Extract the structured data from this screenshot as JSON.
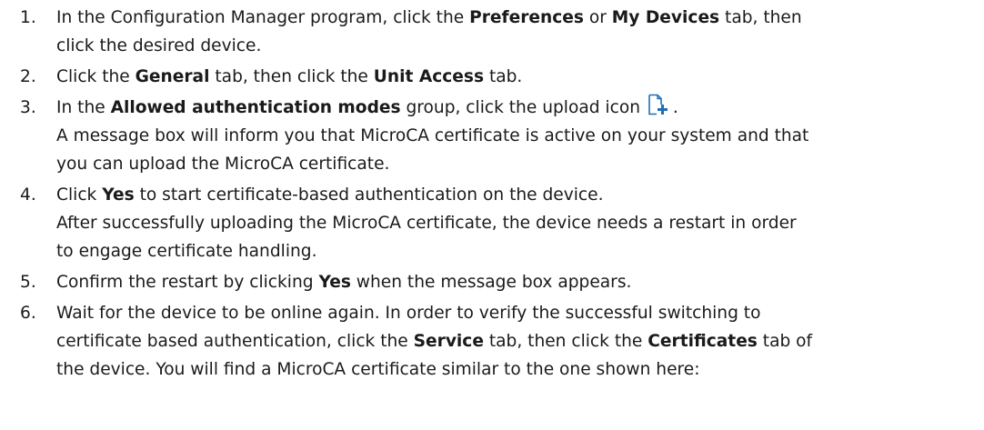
{
  "steps": [
    {
      "number": "1.",
      "lines": [
        [
          {
            "t": "In the Configuration Manager program, click the "
          },
          {
            "t": "Preferences",
            "b": true
          },
          {
            "t": " or "
          },
          {
            "t": "My Devices",
            "b": true
          },
          {
            "t": " tab, then"
          }
        ],
        [
          {
            "t": "click the desired device."
          }
        ]
      ]
    },
    {
      "number": "2.",
      "lines": [
        [
          {
            "t": "Click the "
          },
          {
            "t": "General",
            "b": true
          },
          {
            "t": " tab, then click the "
          },
          {
            "t": "Unit Access",
            "b": true
          },
          {
            "t": " tab."
          }
        ]
      ]
    },
    {
      "number": "3.",
      "lines": [
        [
          {
            "t": "In the "
          },
          {
            "t": "Allowed authentication modes",
            "b": true
          },
          {
            "t": " group, click the upload icon "
          },
          {
            "icon": "upload-icon"
          },
          {
            "t": "."
          }
        ],
        [
          {
            "t": "A message box will inform you that MicroCA certificate is active on your system and that"
          }
        ],
        [
          {
            "t": "you can upload the MicroCA certificate."
          }
        ]
      ]
    },
    {
      "number": "4.",
      "lines": [
        [
          {
            "t": "Click "
          },
          {
            "t": "Yes",
            "b": true
          },
          {
            "t": " to start certificate-based authentication on the device."
          }
        ],
        [
          {
            "t": "After successfully uploading the MicroCA certificate, the device needs a restart in order"
          }
        ],
        [
          {
            "t": "to engage certificate handling."
          }
        ]
      ]
    },
    {
      "number": "5.",
      "lines": [
        [
          {
            "t": "Confirm the restart by clicking "
          },
          {
            "t": "Yes",
            "b": true
          },
          {
            "t": " when the message box appears."
          }
        ]
      ]
    },
    {
      "number": "6.",
      "lines": [
        [
          {
            "t": "Wait for the device to be online again. In order to verify the successful switching to"
          }
        ],
        [
          {
            "t": "certificate based authentication, click the "
          },
          {
            "t": "Service",
            "b": true
          },
          {
            "t": " tab, then click the "
          },
          {
            "t": "Certificates",
            "b": true
          },
          {
            "t": " tab of"
          }
        ],
        [
          {
            "t": "the device. You will find a MicroCA certificate similar to the one shown here:"
          }
        ]
      ]
    }
  ],
  "colors": {
    "text": "#1a1a1a",
    "icon_blue": "#1f6fb5"
  }
}
